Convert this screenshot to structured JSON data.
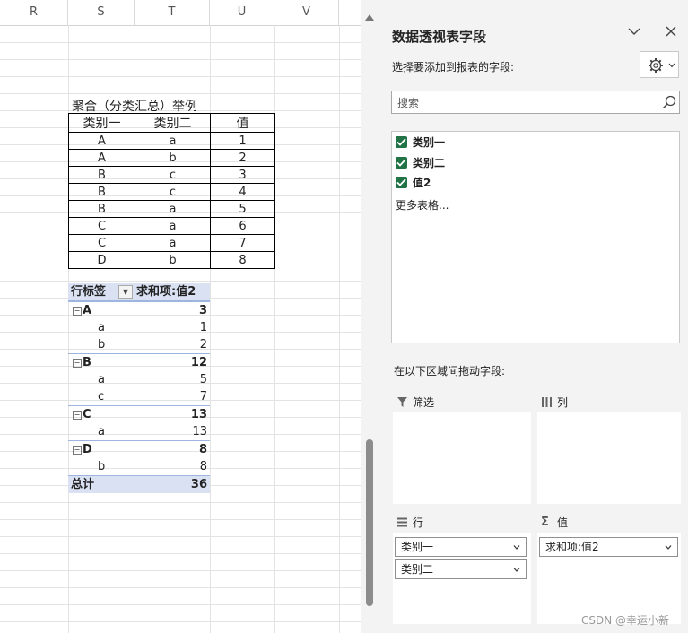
{
  "sheet": {
    "columns": [
      "R",
      "S",
      "T",
      "U",
      "V"
    ],
    "source_title": "聚合（分类汇总）举例",
    "source_headers": [
      "类别一",
      "类别二",
      "值"
    ],
    "source_rows": [
      [
        "A",
        "a",
        "1"
      ],
      [
        "A",
        "b",
        "2"
      ],
      [
        "B",
        "c",
        "3"
      ],
      [
        "B",
        "c",
        "4"
      ],
      [
        "B",
        "a",
        "5"
      ],
      [
        "C",
        "a",
        "6"
      ],
      [
        "C",
        "a",
        "7"
      ],
      [
        "D",
        "b",
        "8"
      ]
    ],
    "pivot": {
      "row_label": "行标签",
      "value_label": "求和项:值2",
      "groups": [
        {
          "name": "A",
          "total": "3",
          "items": [
            {
              "name": "a",
              "value": "1"
            },
            {
              "name": "b",
              "value": "2"
            }
          ]
        },
        {
          "name": "B",
          "total": "12",
          "items": [
            {
              "name": "a",
              "value": "5"
            },
            {
              "name": "c",
              "value": "7"
            }
          ]
        },
        {
          "name": "C",
          "total": "13",
          "items": [
            {
              "name": "a",
              "value": "13"
            }
          ]
        },
        {
          "name": "D",
          "total": "8",
          "items": [
            {
              "name": "b",
              "value": "8"
            }
          ]
        }
      ],
      "grand_total_label": "总计",
      "grand_total": "36"
    }
  },
  "pane": {
    "title": "数据透视表字段",
    "subtitle": "选择要添加到报表的字段:",
    "search_placeholder": "搜索",
    "fields": [
      {
        "label": "类别一",
        "checked": true
      },
      {
        "label": "类别二",
        "checked": true
      },
      {
        "label": "值2",
        "checked": true
      }
    ],
    "more_tables": "更多表格...",
    "drag_hint": "在以下区域间拖动字段:",
    "areas": {
      "filters": {
        "title": "筛选",
        "items": []
      },
      "columns": {
        "title": "列",
        "items": []
      },
      "rows": {
        "title": "行",
        "items": [
          "类别一",
          "类别二"
        ]
      },
      "values": {
        "title": "值",
        "items": [
          "求和项:值2"
        ]
      }
    },
    "accent_color": "#217346"
  },
  "watermark": "CSDN @幸运小新"
}
